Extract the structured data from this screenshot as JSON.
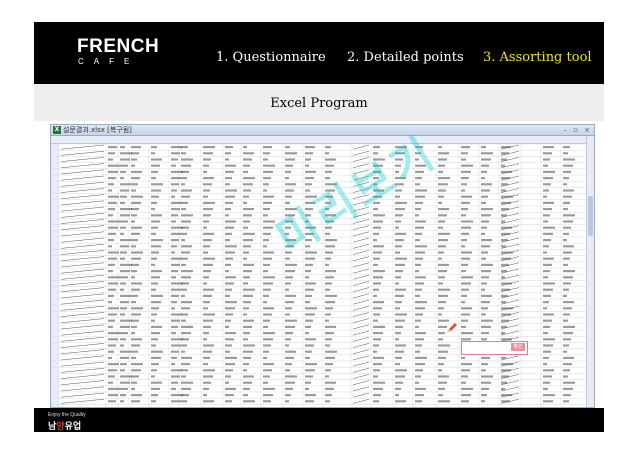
{
  "brand": {
    "name": "FRENCH",
    "sub": "CAFE"
  },
  "nav": [
    {
      "label": "1. Questionnaire",
      "active": false
    },
    {
      "label": "2. Detailed points",
      "active": false
    },
    {
      "label": "3. Assorting tool",
      "active": true
    }
  ],
  "section_title": "Excel Program",
  "excel_window": {
    "app_icon": "excel-icon",
    "title": "설문결과.xlsx [복구됨]",
    "window_buttons": "– ▫ ×"
  },
  "popup": {
    "button": "확인"
  },
  "watermark": "미리보기",
  "footer": {
    "tagline": "Enjoy the Quality",
    "logo_left": "남",
    "logo_mid": "양",
    "logo_right": "유업"
  },
  "colors": {
    "header_bg": "#000000",
    "active_nav": "#f2e21a",
    "band_bg": "#eeeeee",
    "watermark": "#00c8c8"
  }
}
